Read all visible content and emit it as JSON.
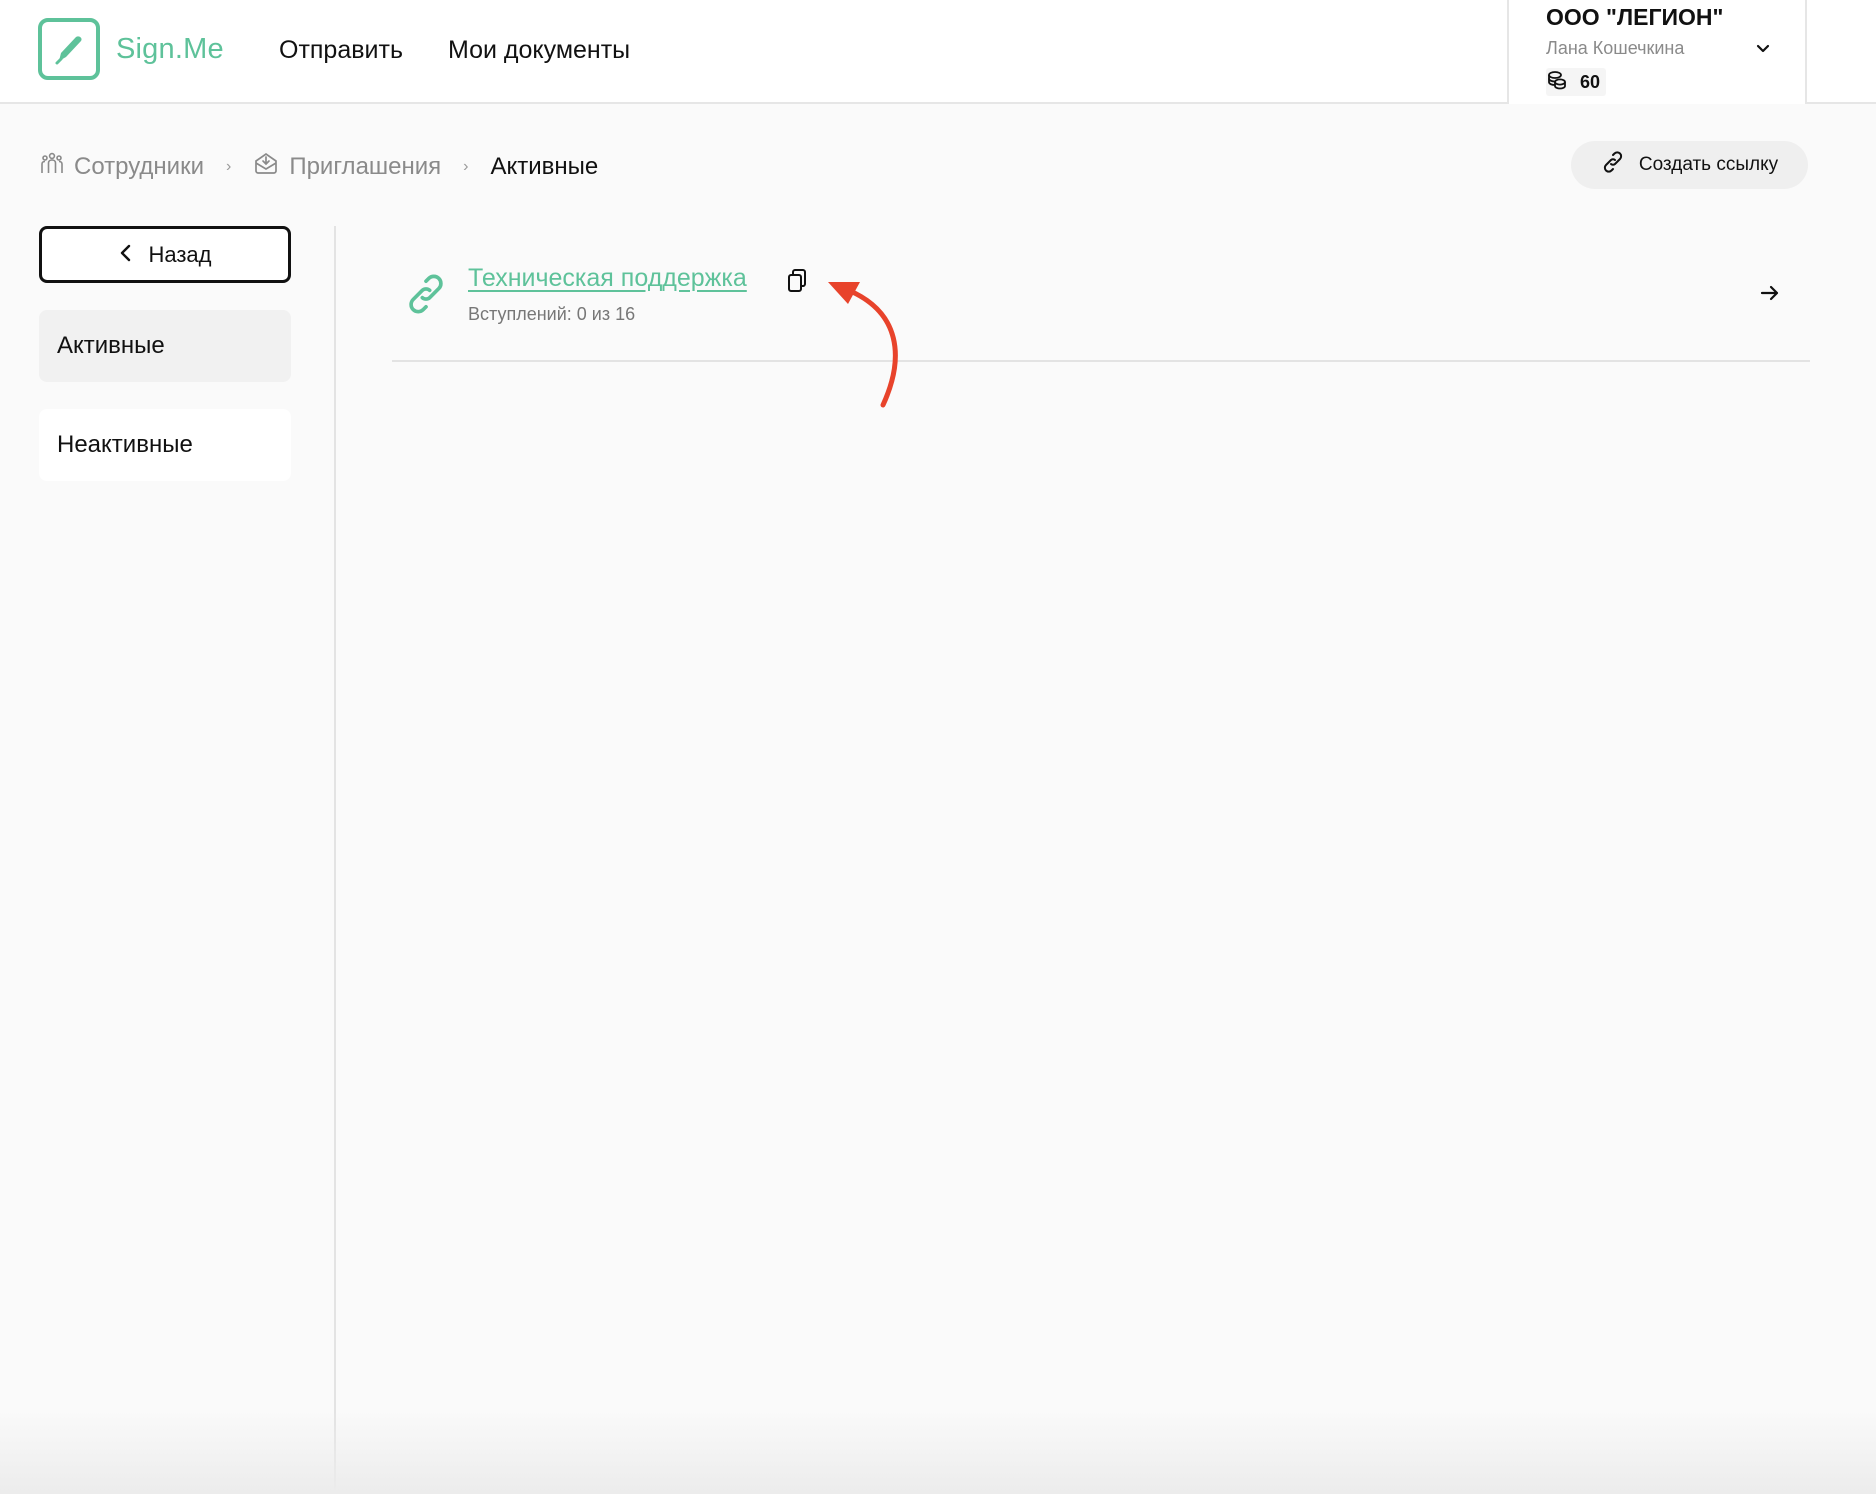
{
  "header": {
    "logo_text": "Sign.Me",
    "nav": [
      "Отправить",
      "Мои документы"
    ],
    "account": {
      "org_name": "ООО \"ЛЕГИОН\"",
      "user_name": "Лана Кошечкина",
      "balance": "60"
    }
  },
  "breadcrumb": [
    {
      "label": "Сотрудники",
      "icon": "people-icon"
    },
    {
      "label": "Приглашения",
      "icon": "invite-icon"
    },
    {
      "label": "Активные"
    }
  ],
  "actions": {
    "create_link_label": "Создать ссылку"
  },
  "sidebar": {
    "back_label": "Назад",
    "items": [
      {
        "label": "Активные",
        "selected": true
      },
      {
        "label": "Неактивные",
        "selected": false
      }
    ]
  },
  "invites": [
    {
      "title": "Техническая поддержка",
      "subtitle": "Вступлений: 0 из 16"
    }
  ],
  "colors": {
    "accent": "#5ec29a",
    "annotation": "#e8432b"
  }
}
